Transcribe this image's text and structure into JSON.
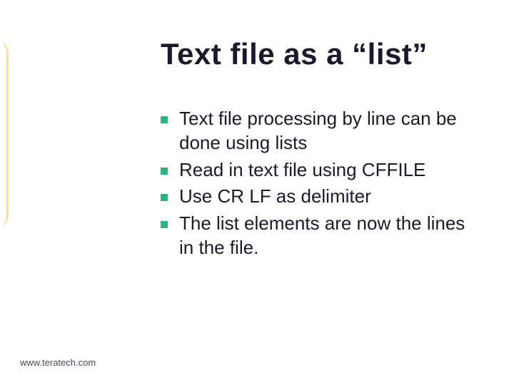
{
  "title": "Text file as a “list”",
  "bullets": [
    "Text file processing by line can be done using lists",
    "Read in text file using CFFILE",
    "Use CR LF as delimiter",
    "The list elements are now the lines in the file."
  ],
  "footer": "www.teratech.com"
}
